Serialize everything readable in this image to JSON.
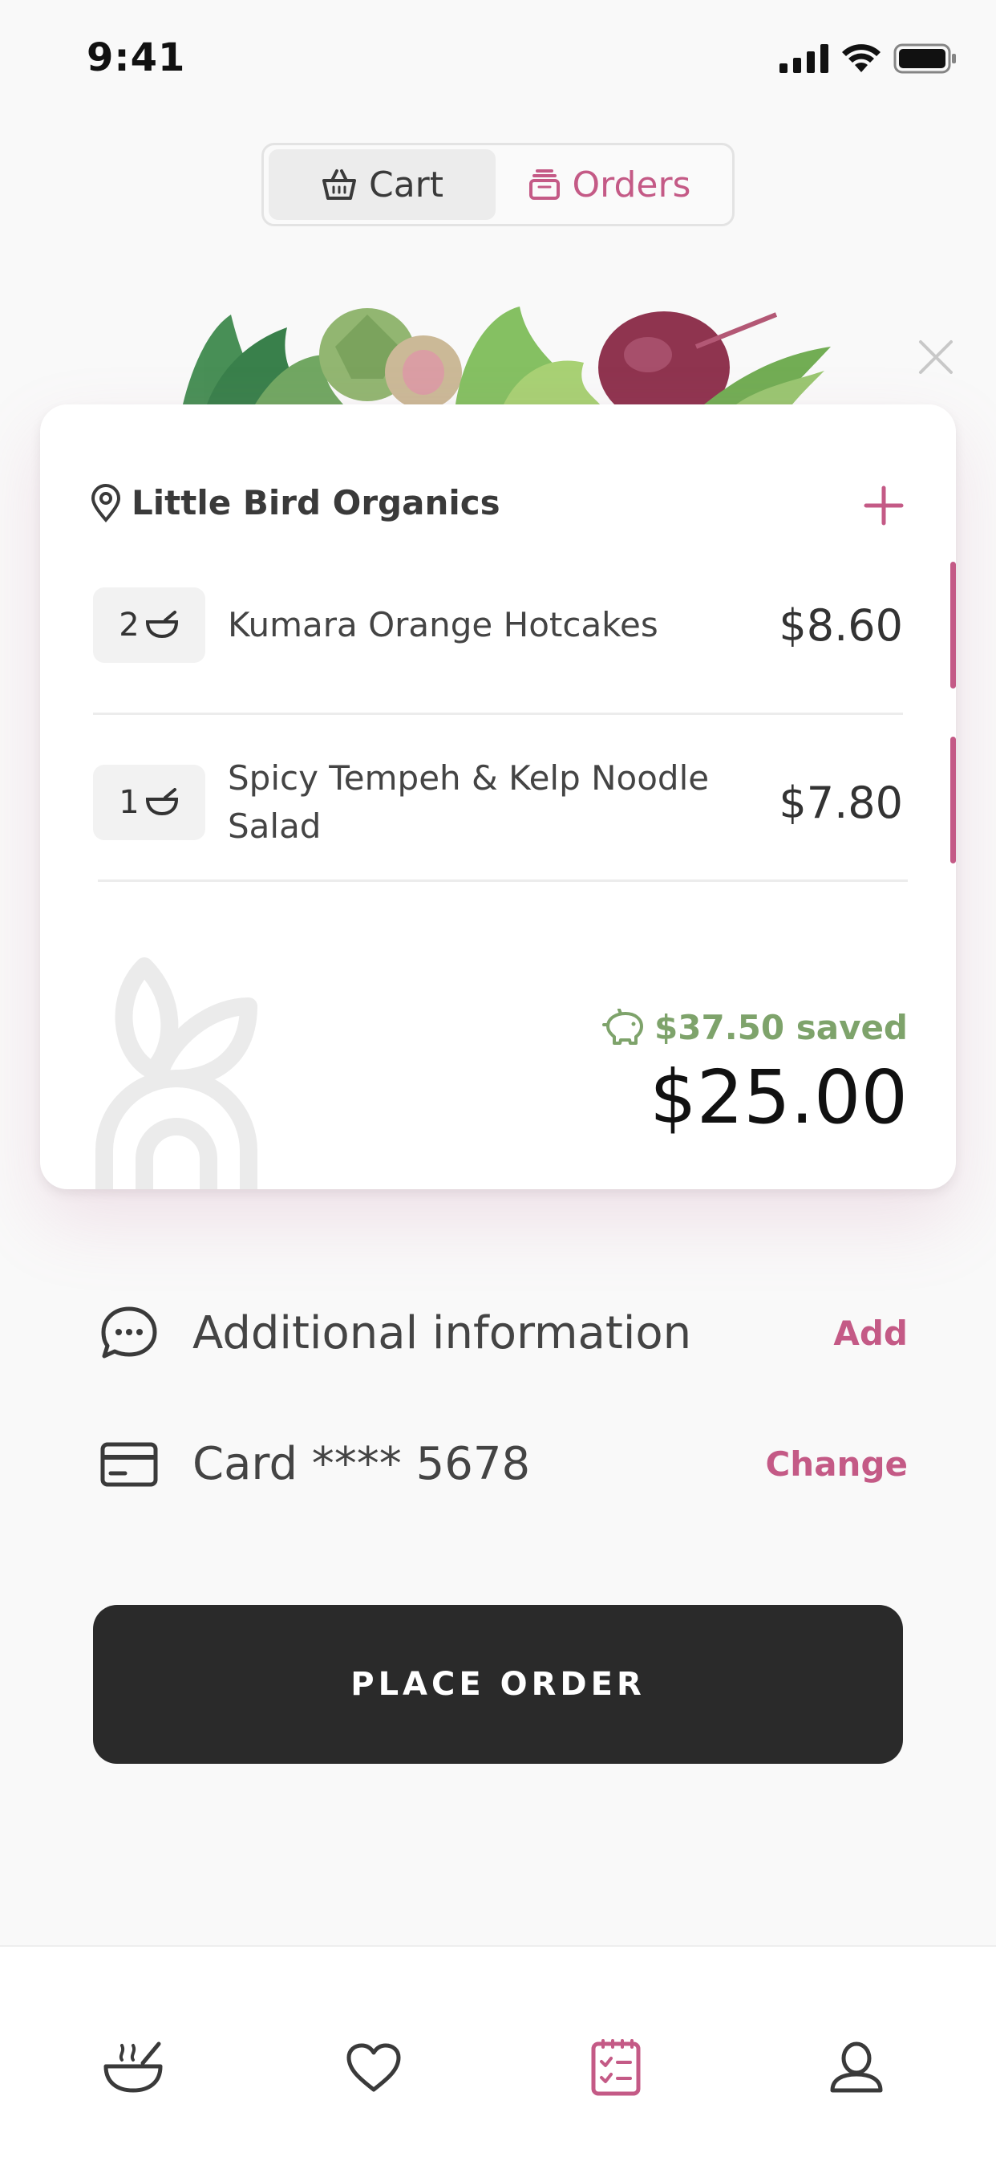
{
  "status_bar": {
    "time": "9:41"
  },
  "segments": {
    "cart_label": "Cart",
    "orders_label": "Orders"
  },
  "vendor": {
    "name": "Little Bird Organics"
  },
  "items": [
    {
      "qty": "2",
      "name": "Kumara Orange Hotcakes",
      "price": "$8.60"
    },
    {
      "qty": "1",
      "name": "Spicy Tempeh & Kelp Noodle Salad",
      "price": "$7.80"
    }
  ],
  "summary": {
    "saved": "$37.50 saved",
    "total": "$25.00"
  },
  "additional_info": {
    "label": "Additional information",
    "action": "Add"
  },
  "payment": {
    "label": "Card **** 5678",
    "action": "Change"
  },
  "place_order": {
    "label": "PLACE ORDER"
  },
  "tabbar": {
    "items": [
      {
        "icon": "bowl-icon",
        "active": false
      },
      {
        "icon": "heart-icon",
        "active": false
      },
      {
        "icon": "order-list-icon",
        "active": true
      },
      {
        "icon": "profile-icon",
        "active": false
      }
    ]
  },
  "colors": {
    "accent": "#c45a86",
    "saved": "#7ea36b",
    "button_dark": "#2a2a2a",
    "background": "#f9f9f9"
  }
}
